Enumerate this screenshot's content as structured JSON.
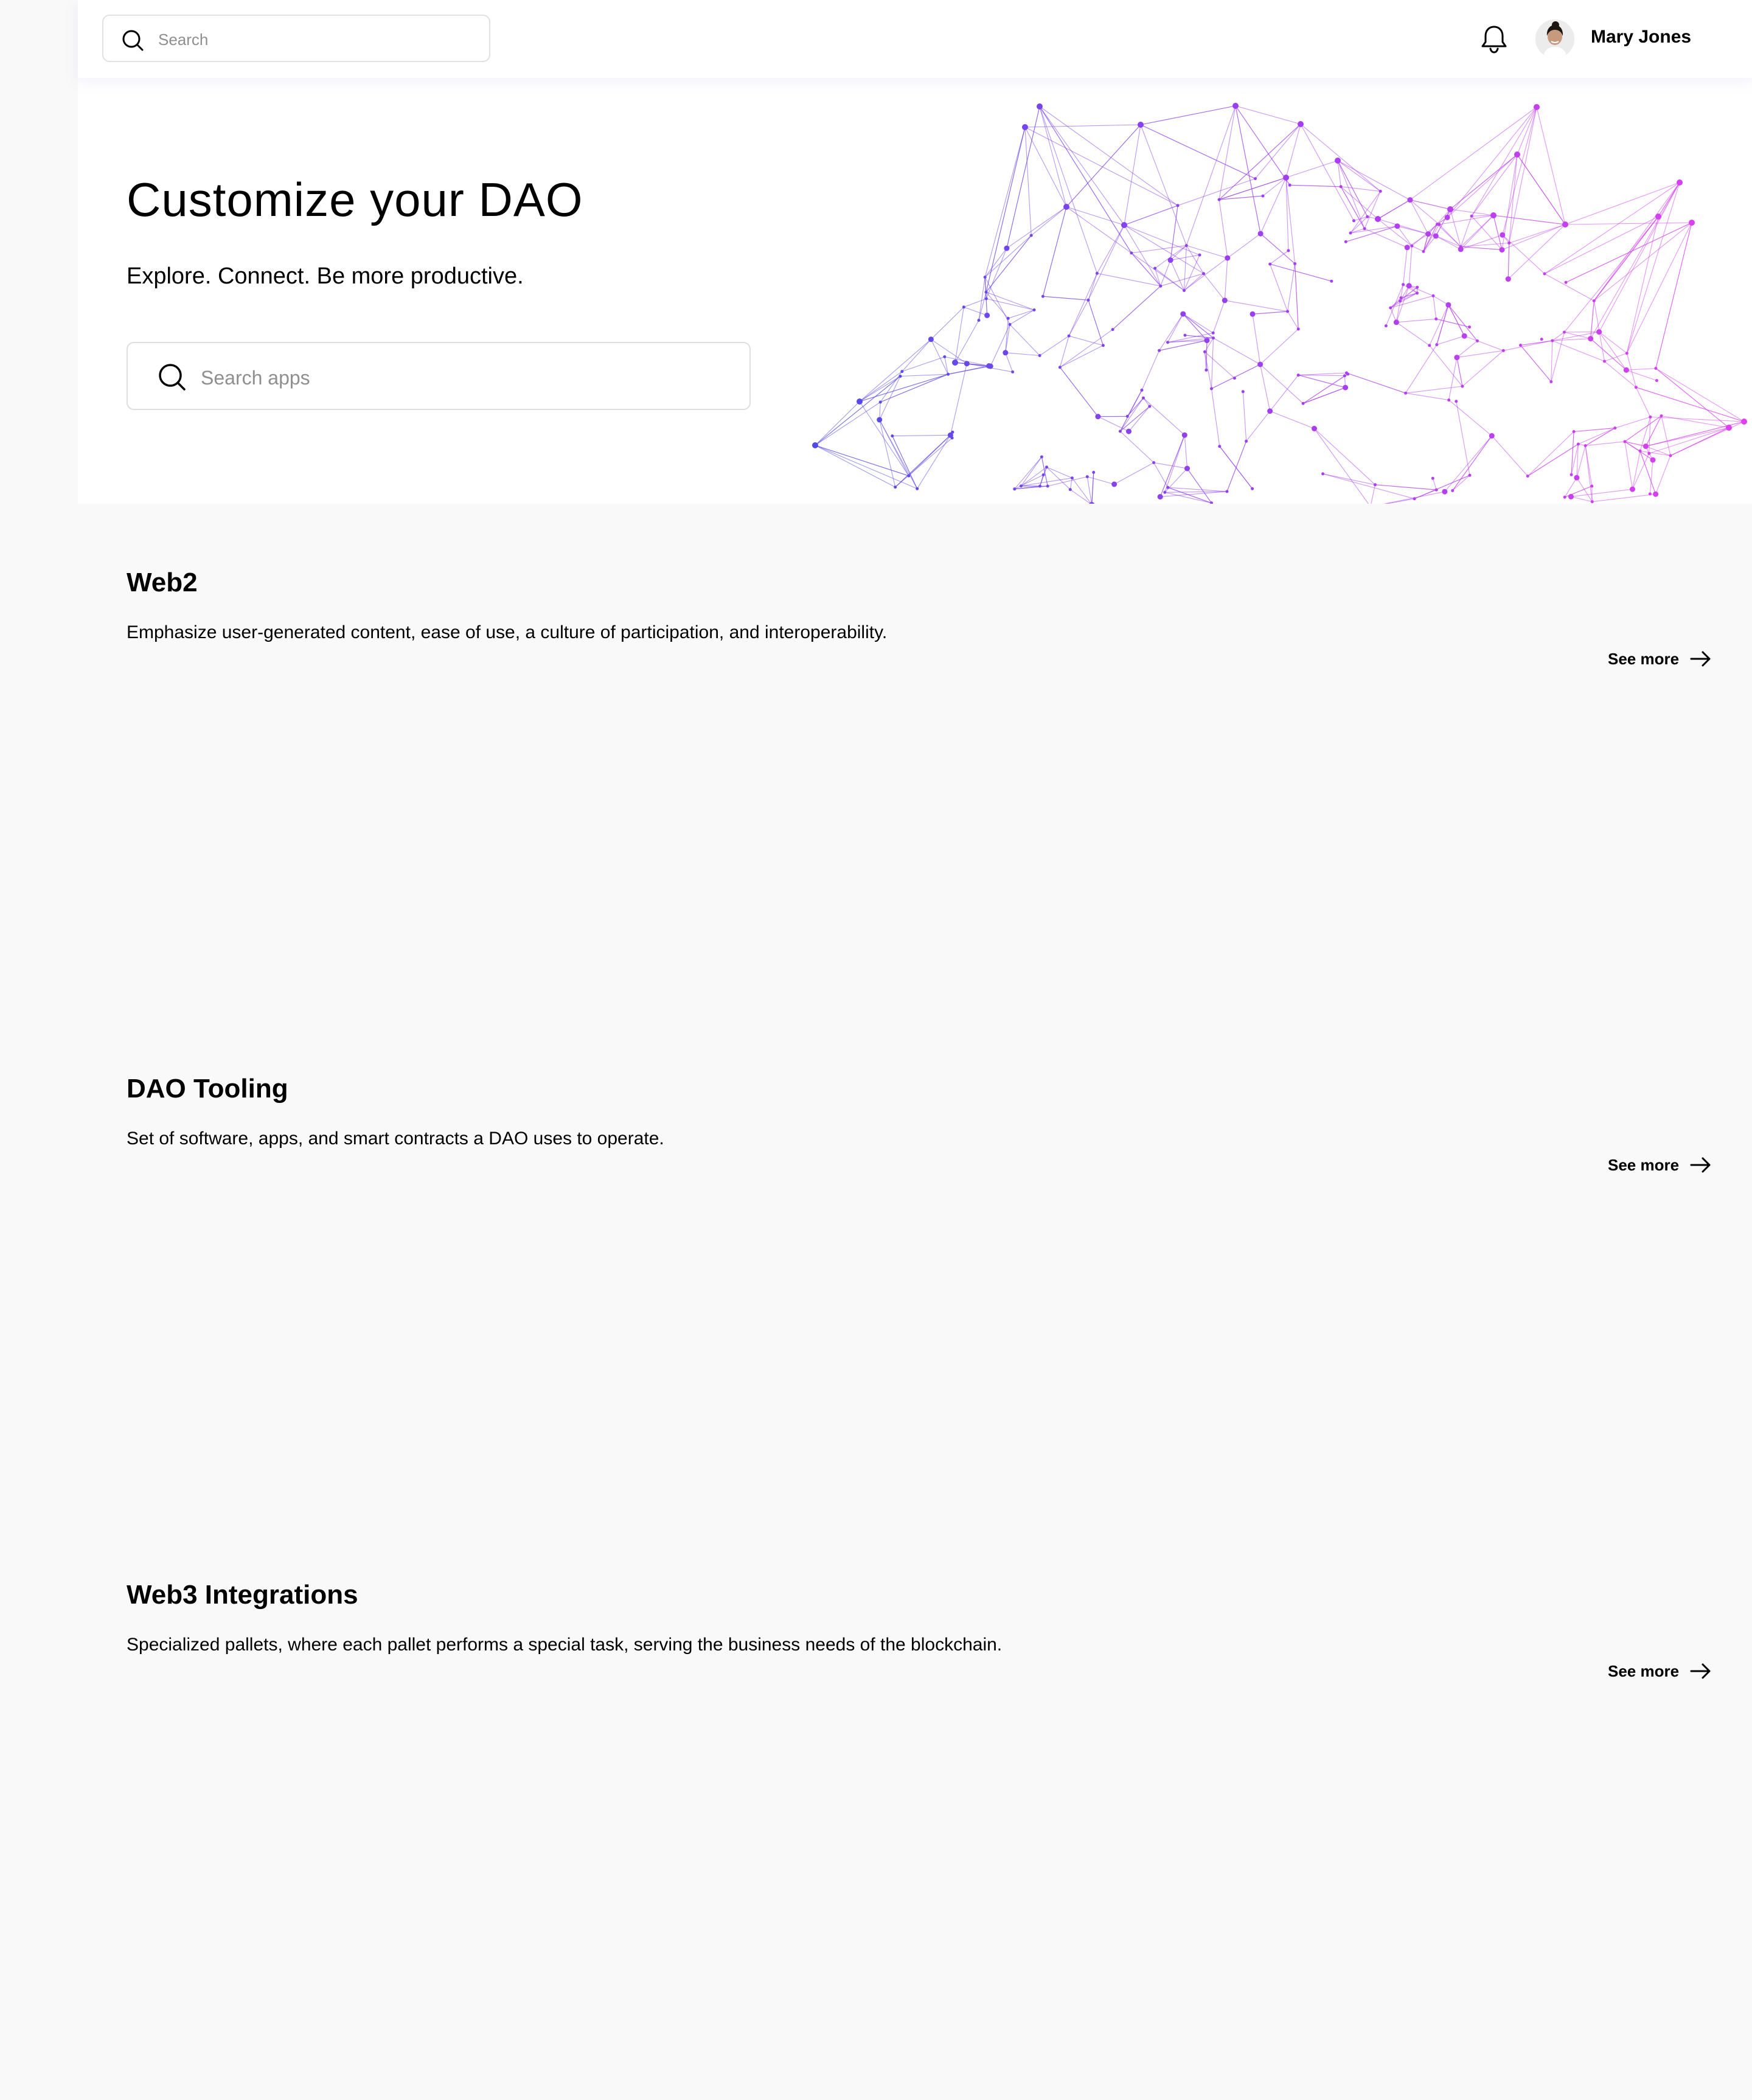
{
  "header": {
    "search_placeholder": "Search",
    "user_name": "Mary Jones",
    "icons": {
      "search": "search-icon",
      "notifications": "bell-icon",
      "menu": "chevron-down-icon"
    }
  },
  "hero": {
    "title": "Customize your DAO",
    "subtitle": "Explore. Connect. Be more productive.",
    "search_placeholder": "Search apps",
    "graphic_colors": [
      "#4c4ce6",
      "#a23ef0",
      "#e040f0"
    ]
  },
  "sections": [
    {
      "title": "Web2",
      "description": "Emphasize user-generated content, ease of use, a culture of participation, and interoperability.",
      "see_more": "See more"
    },
    {
      "title": "DAO Tooling",
      "description": "Set of software, apps, and smart contracts a DAO uses to operate.",
      "see_more": "See more"
    },
    {
      "title": "Web3 Integrations",
      "description": "Specialized pallets, where each pallet performs a special task, serving the business needs of the blockchain.",
      "see_more": "See more"
    }
  ]
}
